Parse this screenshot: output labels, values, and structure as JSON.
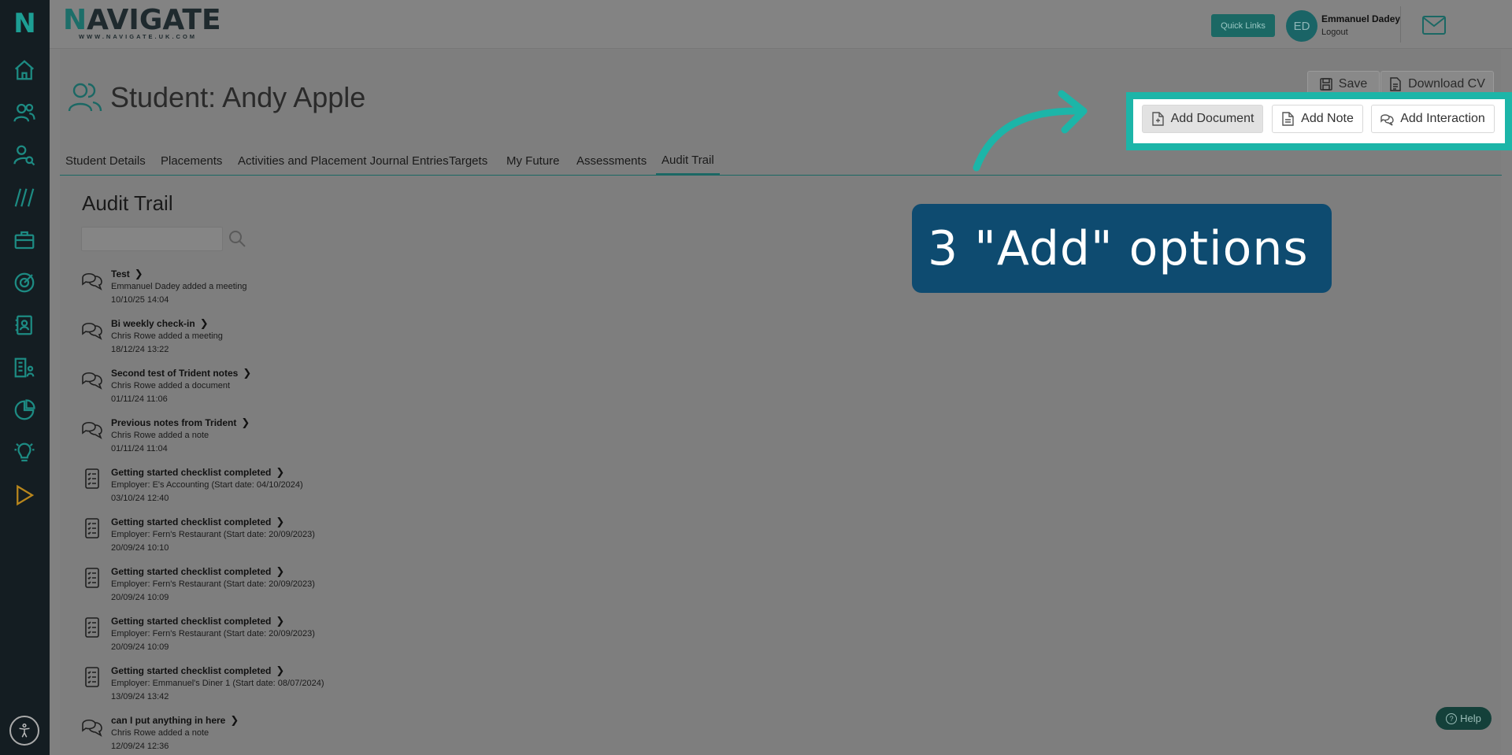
{
  "sidebar": {
    "logo": "N",
    "icons": [
      "home-icon",
      "users-icon",
      "user-search-icon",
      "slashes-icon",
      "briefcase-icon",
      "target-icon",
      "contact-card-icon",
      "building-people-icon",
      "pie-chart-icon",
      "lightbulb-icon",
      "play-icon"
    ],
    "accessibility": "accessibility-icon"
  },
  "header": {
    "brand_prefix": "N",
    "brand_rest": "AVIGATE",
    "brand_url": "WWW.NAVIGATE.UK.COM",
    "quick_links": "Quick Links",
    "avatar_initials": "ED",
    "user_name": "Emmanuel Dadey",
    "logout": "Logout"
  },
  "page": {
    "title": "Student: Andy Apple",
    "save": "Save",
    "download_cv": "Download CV",
    "add_document": "Add Document",
    "add_note": "Add Note",
    "add_interaction": "Add Interaction"
  },
  "tabs": [
    {
      "label": "Student Details"
    },
    {
      "label": "Placements"
    },
    {
      "label": "Activities and Placement Journal Entries"
    },
    {
      "label": "Targets"
    },
    {
      "label": "My Future"
    },
    {
      "label": "Assessments"
    },
    {
      "label": "Audit Trail",
      "active": true
    }
  ],
  "audit": {
    "title": "Audit Trail",
    "search_placeholder": "",
    "entries": [
      {
        "icon": "chat-icon",
        "title": "Test",
        "desc": "Emmanuel Dadey added a meeting",
        "time": "10/10/25 14:04"
      },
      {
        "icon": "chat-icon",
        "title": "Bi weekly check-in",
        "desc": "Chris Rowe added a meeting",
        "time": "18/12/24 13:22"
      },
      {
        "icon": "chat-icon",
        "title": "Second test of Trident notes",
        "desc": "Chris Rowe added a document",
        "time": "01/11/24 11:06"
      },
      {
        "icon": "chat-icon",
        "title": "Previous notes from Trident",
        "desc": "Chris Rowe added a note",
        "time": "01/11/24 11:04"
      },
      {
        "icon": "checklist-icon",
        "title": "Getting started checklist completed",
        "desc": "Employer: E's Accounting (Start date: 04/10/2024)",
        "time": "03/10/24 12:40"
      },
      {
        "icon": "checklist-icon",
        "title": "Getting started checklist completed",
        "desc": "Employer: Fern's Restaurant (Start date: 20/09/2023)",
        "time": "20/09/24 10:10"
      },
      {
        "icon": "checklist-icon",
        "title": "Getting started checklist completed",
        "desc": "Employer: Fern's Restaurant (Start date: 20/09/2023)",
        "time": "20/09/24 10:09"
      },
      {
        "icon": "checklist-icon",
        "title": "Getting started checklist completed",
        "desc": "Employer: Fern's Restaurant (Start date: 20/09/2023)",
        "time": "20/09/24 10:09"
      },
      {
        "icon": "checklist-icon",
        "title": "Getting started checklist completed",
        "desc": "Employer: Emmanuel's Diner 1 (Start date: 08/07/2024)",
        "time": "13/09/24 13:42"
      },
      {
        "icon": "chat-icon",
        "title": "can I put anything in here",
        "desc": "Chris Rowe added a note",
        "time": "12/09/24 12:36"
      }
    ]
  },
  "callout": {
    "text": "3 \"Add\" options"
  },
  "help": {
    "label": "Help"
  },
  "colors": {
    "accent": "#1b6864",
    "highlight": "#1cb5a8",
    "callout_bg": "#0e4b70",
    "sidebar_bg": "#141d22"
  }
}
